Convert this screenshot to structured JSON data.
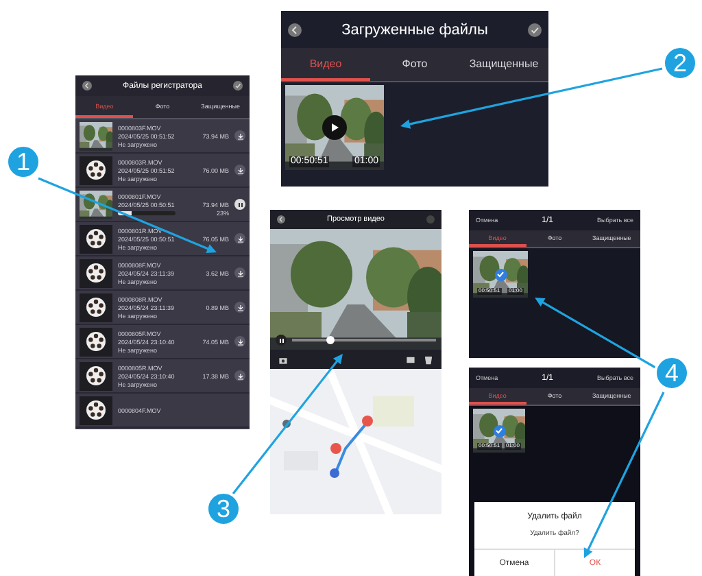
{
  "recorder_files": {
    "title": "Файлы регистратора",
    "tabs": [
      {
        "label": "Видео",
        "selected": true
      },
      {
        "label": "Фото",
        "selected": false
      },
      {
        "label": "Защищенные",
        "selected": false
      }
    ],
    "files": [
      {
        "name": "0000803F.MOV",
        "date": "2024/05/25 00:51:52",
        "size": "73.94 MB",
        "kind": "idle",
        "has_preview": true,
        "status": "Не загружено"
      },
      {
        "name": "0000803R.MOV",
        "date": "2024/05/25 00:51:52",
        "size": "76.00 MB",
        "kind": "idle",
        "has_preview": false,
        "status": "Не загружено"
      },
      {
        "name": "0000801F.MOV",
        "date": "2024/05/25 00:50:51",
        "size": "73.94 MB",
        "kind": "downloading",
        "has_preview": true,
        "level": 0.23,
        "reading": "23%"
      },
      {
        "name": "0000801R.MOV",
        "date": "2024/05/25 00:50:51",
        "size": "76.05 MB",
        "kind": "idle",
        "has_preview": false,
        "status": "Не загружено"
      },
      {
        "name": "0000808F.MOV",
        "date": "2024/05/24 23:11:39",
        "size": "3.62 MB",
        "kind": "idle",
        "has_preview": false,
        "status": "Не загружено"
      },
      {
        "name": "0000808R.MOV",
        "date": "2024/05/24 23:11:39",
        "size": "0.89 MB",
        "kind": "idle",
        "has_preview": false,
        "status": "Не загружено"
      },
      {
        "name": "0000805F.MOV",
        "date": "2024/05/24 23:10:40",
        "size": "74.05 MB",
        "kind": "idle",
        "has_preview": false,
        "status": "Не загружено"
      },
      {
        "name": "0000805R.MOV",
        "date": "2024/05/24 23:10:40",
        "size": "17.38 MB",
        "kind": "idle",
        "has_preview": false,
        "status": "Не загружено"
      },
      {
        "name": "0000804F.MOV",
        "kind": "partial",
        "has_preview": false
      }
    ]
  },
  "downloaded_files": {
    "title": "Загруженные файлы",
    "tabs": [
      {
        "label": "Видео",
        "selected": true
      },
      {
        "label": "Фото",
        "selected": false
      },
      {
        "label": "Защищенные",
        "selected": false
      }
    ],
    "videos": [
      {
        "start": "00:50:51",
        "duration": "01:00"
      }
    ]
  },
  "video_player": {
    "title": "Просмотр видео",
    "playing": true,
    "level": 0.27
  },
  "select_screen": {
    "cancel": "Отмена",
    "count": "1/1",
    "select_all": "Выбрать все",
    "tabs": [
      {
        "label": "Видео",
        "selected": true
      },
      {
        "label": "Фото",
        "selected": false
      },
      {
        "label": "Защищенные",
        "selected": false
      }
    ],
    "videos": [
      {
        "start": "00:50:51",
        "duration": "01:00",
        "checked": true
      }
    ]
  },
  "delete_screen": {
    "cancel": "Отмена",
    "count": "1/1",
    "select_all": "Выбрать все",
    "tabs": [
      {
        "label": "Видео",
        "selected": true
      },
      {
        "label": "Фото",
        "selected": false
      },
      {
        "label": "Защищенные",
        "selected": false
      }
    ],
    "videos": [
      {
        "checked": true,
        "start": "00:50:51",
        "duration": "01:00"
      }
    ],
    "dialog": {
      "title": "Удалить файл",
      "message": "Удалить файл?",
      "buttons": [
        {
          "label": "Отмена",
          "kind": "cancel"
        },
        {
          "label": "ОК",
          "kind": "confirm"
        }
      ]
    }
  },
  "callouts": [
    {
      "label": "1"
    },
    {
      "label": "2"
    },
    {
      "label": "3"
    },
    {
      "label": "4"
    }
  ]
}
